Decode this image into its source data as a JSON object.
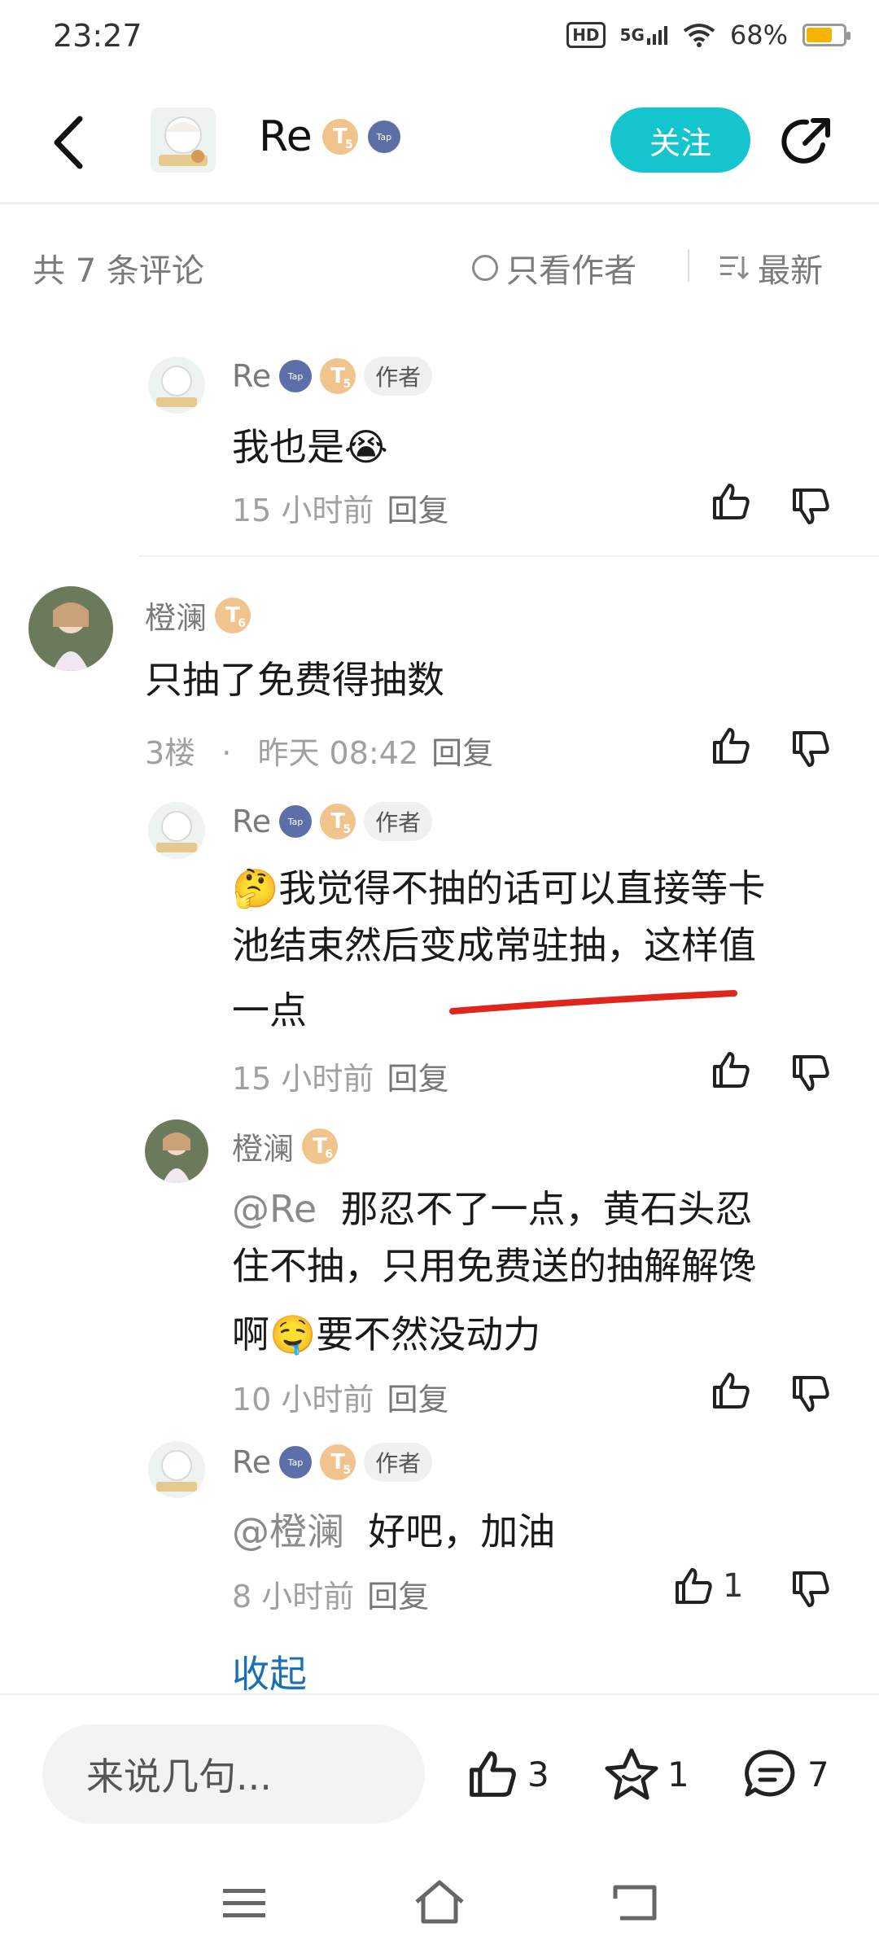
{
  "status_bar": {
    "time": "23:27",
    "hd": "HD",
    "network": "5G",
    "battery": "68%"
  },
  "header": {
    "username": "Re",
    "follow_label": "关注",
    "tap_badge": "Tap",
    "level_badge": "T"
  },
  "comments_bar": {
    "total": "共 7 条评论",
    "author_only": "只看作者",
    "sort": "最新"
  },
  "comments": [
    {
      "user": "Re",
      "author_tag": "作者",
      "text": "我也是😭",
      "time": "15 小时前",
      "reply": "回复"
    },
    {
      "user": "橙澜",
      "text": "只抽了免费得抽数",
      "floor": "3楼",
      "dot": "·",
      "time": "昨天 08:42",
      "reply": "回复"
    },
    {
      "user": "Re",
      "author_tag": "作者",
      "text_line1": "🤔我觉得不抽的话可以直接等卡",
      "text_line2": "池结束然后变成常驻抽，这样值",
      "text_line3": "一点",
      "time": "15 小时前",
      "reply": "回复"
    },
    {
      "user": "橙澜",
      "mention": "@Re",
      "text_line1": "那忍不了一点，黄石头忍",
      "text_line2": "住不抽，只用免费送的抽解解馋",
      "text_line3": "啊🤤要不然没动力",
      "time": "10 小时前",
      "reply": "回复"
    },
    {
      "user": "Re",
      "author_tag": "作者",
      "mention": "@橙澜",
      "text": "好吧，加油",
      "time": "8 小时前",
      "reply": "回复",
      "likes": "1"
    }
  ],
  "collapse_label": "收起",
  "bottom_bar": {
    "input_placeholder": "来说几句...",
    "like_count": "3",
    "fav_count": "1",
    "comment_count": "7"
  }
}
